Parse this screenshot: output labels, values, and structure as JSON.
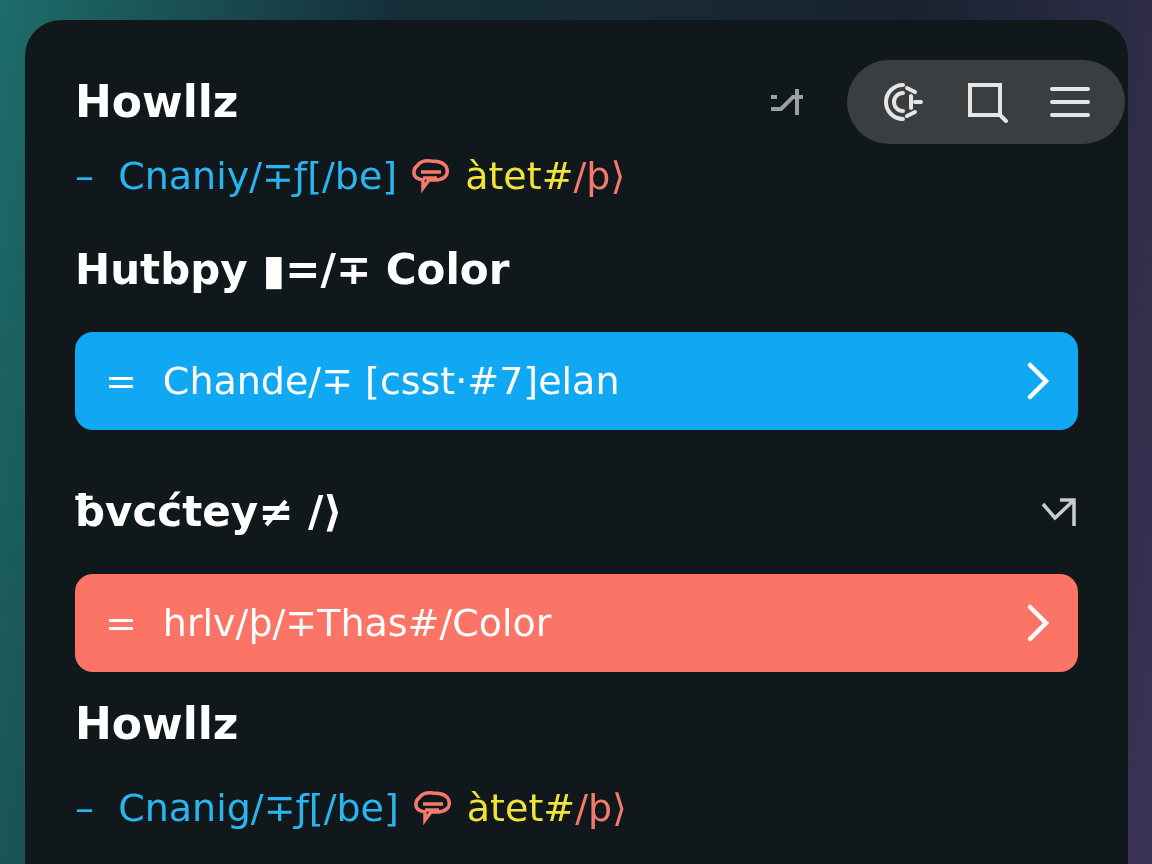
{
  "blocks": [
    {
      "kind": "title",
      "text": "Howllz"
    },
    {
      "kind": "code",
      "before": [
        {
          "text": "–  Cnaniy/∓ƒ[/be]",
          "color": "#29b6f0"
        }
      ],
      "after": [
        {
          "text": "àtet#",
          "color": "#f2e33a"
        },
        {
          "text": "/þ⟩",
          "color": "#f47a6c"
        }
      ]
    },
    {
      "kind": "heading",
      "text": "Hutbpy ▮=/∓ Color"
    },
    {
      "kind": "bar",
      "mark": "=",
      "text": "Chande/∓ [csst·#7]elan",
      "color": "#10a8f2"
    },
    {
      "kind": "heading",
      "text": "ƀvcćtey≠ /⟩",
      "icon": true
    },
    {
      "kind": "bar",
      "mark": "=",
      "text": "hrlv/þ/∓Thas#/Color",
      "color": "#fb7466"
    },
    {
      "kind": "title",
      "text": "Howllz"
    },
    {
      "kind": "code",
      "before": [
        {
          "text": "–  Cnanig/∓ƒ[/be]",
          "color": "#29b6f0"
        }
      ],
      "after": [
        {
          "text": "àtet#",
          "color": "#f2e33a"
        },
        {
          "text": "/þ⟩",
          "color": "#f47a6c"
        }
      ]
    }
  ]
}
